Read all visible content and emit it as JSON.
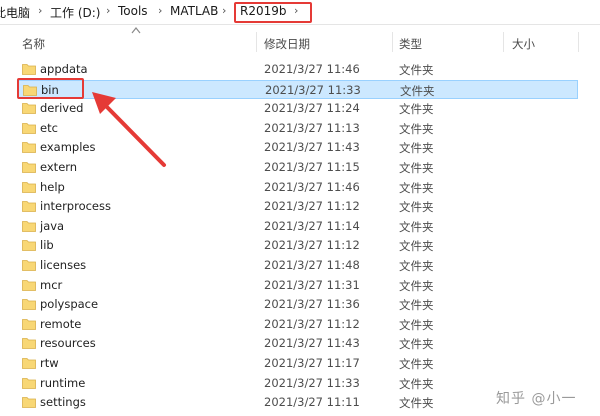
{
  "breadcrumb": {
    "items": [
      "此电脑",
      "工作 (D:)",
      "Tools",
      "MATLAB",
      "R2019b"
    ],
    "highlighted_index": 4
  },
  "columns": {
    "name": "名称",
    "date": "修改日期",
    "type": "类型",
    "size": "大小"
  },
  "rows": [
    {
      "name": "appdata",
      "date": "2021/3/27 11:46",
      "type": "文件夹"
    },
    {
      "name": "bin",
      "date": "2021/3/27 11:33",
      "type": "文件夹",
      "selected": true
    },
    {
      "name": "derived",
      "date": "2021/3/27 11:24",
      "type": "文件夹"
    },
    {
      "name": "etc",
      "date": "2021/3/27 11:13",
      "type": "文件夹"
    },
    {
      "name": "examples",
      "date": "2021/3/27 11:43",
      "type": "文件夹"
    },
    {
      "name": "extern",
      "date": "2021/3/27 11:15",
      "type": "文件夹"
    },
    {
      "name": "help",
      "date": "2021/3/27 11:46",
      "type": "文件夹"
    },
    {
      "name": "interprocess",
      "date": "2021/3/27 11:12",
      "type": "文件夹"
    },
    {
      "name": "java",
      "date": "2021/3/27 11:14",
      "type": "文件夹"
    },
    {
      "name": "lib",
      "date": "2021/3/27 11:12",
      "type": "文件夹"
    },
    {
      "name": "licenses",
      "date": "2021/3/27 11:48",
      "type": "文件夹"
    },
    {
      "name": "mcr",
      "date": "2021/3/27 11:31",
      "type": "文件夹"
    },
    {
      "name": "polyspace",
      "date": "2021/3/27 11:36",
      "type": "文件夹"
    },
    {
      "name": "remote",
      "date": "2021/3/27 11:12",
      "type": "文件夹"
    },
    {
      "name": "resources",
      "date": "2021/3/27 11:43",
      "type": "文件夹"
    },
    {
      "name": "rtw",
      "date": "2021/3/27 11:17",
      "type": "文件夹"
    },
    {
      "name": "runtime",
      "date": "2021/3/27 11:33",
      "type": "文件夹"
    },
    {
      "name": "settings",
      "date": "2021/3/27 11:11",
      "type": "文件夹"
    }
  ],
  "watermark": "知乎 @小一",
  "colors": {
    "annotation": "#e53a36",
    "selection_bg": "#cce8ff",
    "folder": "#f8d775"
  },
  "icons": {
    "folder": "folder-icon",
    "sort": "sort-ascending-icon",
    "separator": "chevron-right-icon"
  }
}
